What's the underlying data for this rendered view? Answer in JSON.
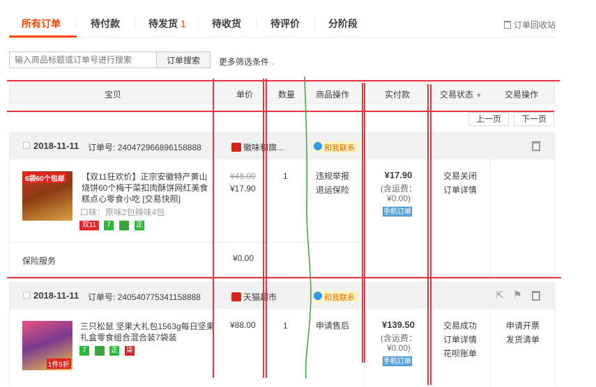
{
  "tabs": [
    {
      "label": "所有订单",
      "active": true
    },
    {
      "label": "待付款"
    },
    {
      "label": "待发货",
      "count": "1"
    },
    {
      "label": "待收货"
    },
    {
      "label": "待评价"
    },
    {
      "label": "分阶段"
    }
  ],
  "recycle_bin": "订单回收站",
  "search": {
    "placeholder": "输入商品标题或订单号进行搜索",
    "button": "订单搜索",
    "more_filters": "更多筛选条件"
  },
  "columns": [
    "宝贝",
    "单价",
    "数量",
    "商品操作",
    "实付款",
    "交易状态",
    "交易操作"
  ],
  "pager": {
    "prev": "上一页",
    "next": "下一页"
  },
  "orders": [
    {
      "date": "2018-11-11",
      "order_no_label": "订单号:",
      "order_no": "240472966896158888",
      "shop": "徽味和旗...",
      "contact": "和我联系",
      "thumb_text": "6袋60个包邮",
      "title": "【双11狂欢价】正宗安徽特产黄山烧饼60个梅干菜扣肉酥饼网红美食糕点心零食小吃 [交易快照]",
      "attr": "口味：原味2包辣味4包",
      "badges": [
        "双11",
        "7",
        "",
        "正"
      ],
      "price_old": "¥48.00",
      "price": "¥17.90",
      "qty": "1",
      "ops": [
        "违规举报",
        "退运保险"
      ],
      "paid": "¥17.90",
      "shipping": "(含运费：¥0.00)",
      "mobile": "手机订单",
      "status": [
        "交易关闭",
        "订单详情"
      ],
      "actions": [],
      "service": {
        "label": "保险服务",
        "price": "¥0.00"
      }
    },
    {
      "date": "2018-11-11",
      "order_no_label": "订单号:",
      "order_no": "240540775341158888",
      "shop": "天猫超市",
      "contact": "和我联系",
      "thumb_text": "1件5折",
      "title": "三只松鼠 坚果大礼包1563g每日坚果礼盒零食组合混合装7袋装",
      "badges": [
        "7",
        "",
        "正",
        "柒"
      ],
      "price": "¥88.00",
      "qty": "1",
      "ops": [
        "申请售后"
      ],
      "paid": "¥139.50",
      "shipping": "(含运费：¥0.00)",
      "mobile": "手机订单",
      "status": [
        "交易成功",
        "订单详情",
        "花呗账单"
      ],
      "actions": [
        "申请开票",
        "发货清单"
      ]
    }
  ],
  "colors": {
    "accent": "#ff4400",
    "annotation_red": "#e8343b",
    "annotation_green": "#3aa33a"
  }
}
